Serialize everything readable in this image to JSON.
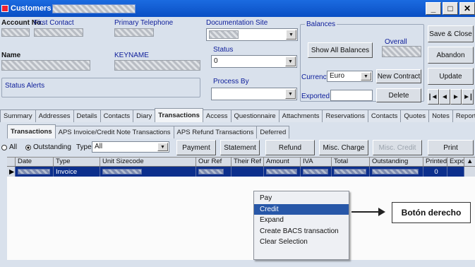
{
  "window": {
    "title": "Customers"
  },
  "header": {
    "account_no_label": "Account No.",
    "first_contact_label": "First Contact",
    "primary_telephone_label": "Primary Telephone",
    "documentation_site_label": "Documentation Site",
    "name_label": "Name",
    "keyname_label": "KEYNAME",
    "status_label": "Status",
    "status_value": "0",
    "process_by_label": "Process By",
    "status_alerts_label": "Status Alerts"
  },
  "balances": {
    "label": "Balances",
    "overall_label": "Overall",
    "show_all_label": "Show All Balances",
    "currency_label": "Currency",
    "currency_value": "Euro",
    "exported_label": "Exported",
    "new_contract_label": "New Contract",
    "delete_label": "Delete"
  },
  "side_buttons": {
    "save_close": "Save & Close",
    "abandon": "Abandon",
    "update": "Update",
    "nav": [
      "|◄",
      "◄",
      "►",
      "►|"
    ]
  },
  "main_tabs": [
    "Summary",
    "Addresses",
    "Details",
    "Contacts",
    "Diary",
    "Transactions",
    "Access",
    "Questionnaire",
    "Attachments",
    "Reservations",
    "Contacts",
    "Quotes",
    "Notes",
    "Reports"
  ],
  "sub_tabs": [
    "Transactions",
    "APS Invoice/Credit Note Transactions",
    "APS Refund Transactions",
    "Deferred"
  ],
  "filter": {
    "all_label": "All",
    "outstanding_label": "Outstanding",
    "type_label": "Type",
    "type_value": "All"
  },
  "action_buttons": {
    "payment": "Payment",
    "statement": "Statement",
    "refund": "Refund",
    "misc_charge": "Misc. Charge",
    "misc_credit": "Misc. Credit",
    "print": "Print"
  },
  "grid": {
    "columns": [
      "Date",
      "Type",
      "Unit Sizecode",
      "Our Ref",
      "Their Ref",
      "Amount",
      "IVA",
      "Total",
      "Outstanding",
      "Printed",
      "Expor"
    ],
    "rows": [
      {
        "type": "Invoice",
        "printed": "0"
      }
    ]
  },
  "context_menu": {
    "items": [
      "Pay",
      "Credit",
      "Expand",
      "Create BACS transaction",
      "Clear Selection"
    ],
    "selected_index": 1
  },
  "annotation": {
    "text": "Botón derecho"
  }
}
